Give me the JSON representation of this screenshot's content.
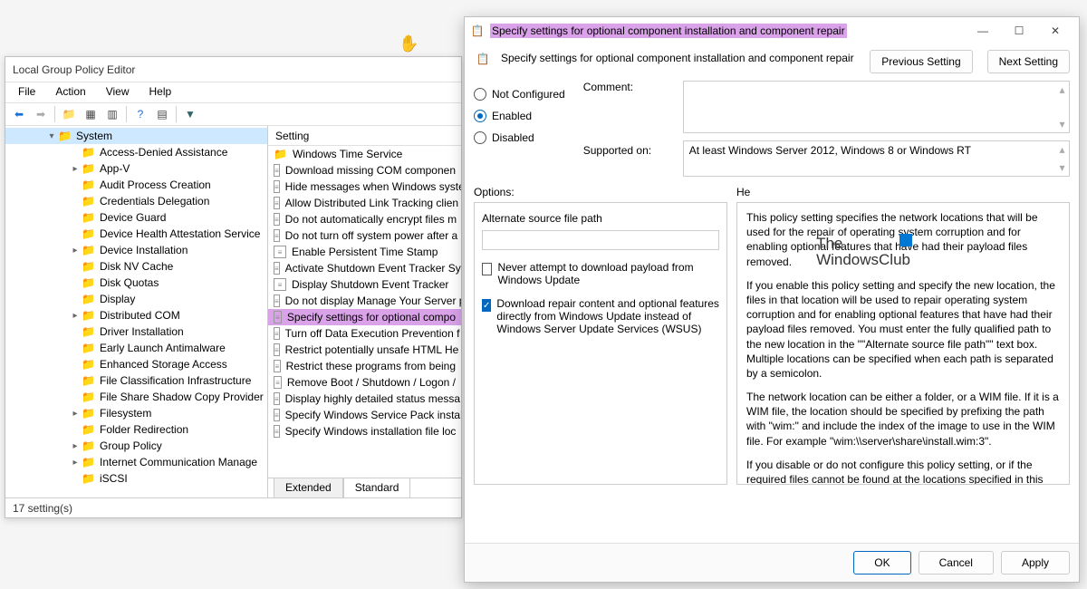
{
  "gpedit": {
    "window_title": "Local Group Policy Editor",
    "menu": {
      "file": "File",
      "action": "Action",
      "view": "View",
      "help": "Help"
    },
    "tree": {
      "system_label": "System",
      "items": [
        "Access-Denied Assistance",
        "App-V",
        "Audit Process Creation",
        "Credentials Delegation",
        "Device Guard",
        "Device Health Attestation Service",
        "Device Installation",
        "Disk NV Cache",
        "Disk Quotas",
        "Display",
        "Distributed COM",
        "Driver Installation",
        "Early Launch Antimalware",
        "Enhanced Storage Access",
        "File Classification Infrastructure",
        "File Share Shadow Copy Provider",
        "Filesystem",
        "Folder Redirection",
        "Group Policy",
        "Internet Communication Manage",
        "iSCSI"
      ],
      "expandable_indices": [
        1,
        6,
        10,
        16,
        18,
        19
      ]
    },
    "list": {
      "header": "Setting",
      "items": [
        "Windows Time Service",
        "Download missing COM componen",
        "Hide messages when Windows syste",
        "Allow Distributed Link Tracking clien",
        "Do not automatically encrypt files m",
        "Do not turn off system power after a",
        "Enable Persistent Time Stamp",
        "Activate Shutdown Event Tracker Sys",
        "Display Shutdown Event Tracker",
        "Do not display Manage Your Server p",
        "Specify settings for optional compo",
        "Turn off Data Execution Prevention f",
        "Restrict potentially unsafe HTML He",
        "Restrict these programs from being",
        "Remove Boot / Shutdown / Logon /",
        "Display highly detailed status messa",
        "Specify Windows Service Pack instal",
        "Specify Windows installation file loc"
      ],
      "folder_index": 0,
      "selected_index": 10
    },
    "tabs": {
      "extended": "Extended",
      "standard": "Standard"
    },
    "status": "17 setting(s)"
  },
  "dialog": {
    "title": "Specify settings for optional component installation and component repair",
    "heading": "Specify settings for optional component installation and component repair",
    "prev_btn": "Previous Setting",
    "next_btn": "Next Setting",
    "radios": {
      "not_configured": "Not Configured",
      "enabled": "Enabled",
      "disabled": "Disabled"
    },
    "comment_label": "Comment:",
    "supported_label": "Supported on:",
    "supported_value": "At least Windows Server 2012, Windows 8 or Windows RT",
    "options_label": "Options:",
    "help_label": "He",
    "option_alt_path_label": "Alternate source file path",
    "option_chk1": "Never attempt to download payload from Windows Update",
    "option_chk2": "Download repair content and optional features directly from Windows Update instead of Windows Server Update Services (WSUS)",
    "help_paragraphs": [
      "This policy setting specifies the network locations that will be used for the repair of operating system corruption and for enabling optional features that have had their payload files removed.",
      "If you enable this policy setting and specify the new location, the files in that location will be used to repair operating system corruption and for enabling optional features that have had their payload files removed. You must enter the fully qualified path to the new location in the \"\"Alternate source file path\"\" text box. Multiple locations can be specified when each path is separated by a semicolon.",
      "The network location can be either a folder, or a WIM file. If it is a WIM file, the location should be specified by prefixing the path with \"wim:\" and include the index of the image to use in the WIM file. For example \"wim:\\\\server\\share\\install.wim:3\".",
      "If you disable or do not configure this policy setting, or if the required files cannot be found at the locations specified in this"
    ],
    "footer": {
      "ok": "OK",
      "cancel": "Cancel",
      "apply": "Apply"
    }
  },
  "watermark": {
    "line1": "The",
    "line2": "WindowsClub"
  }
}
